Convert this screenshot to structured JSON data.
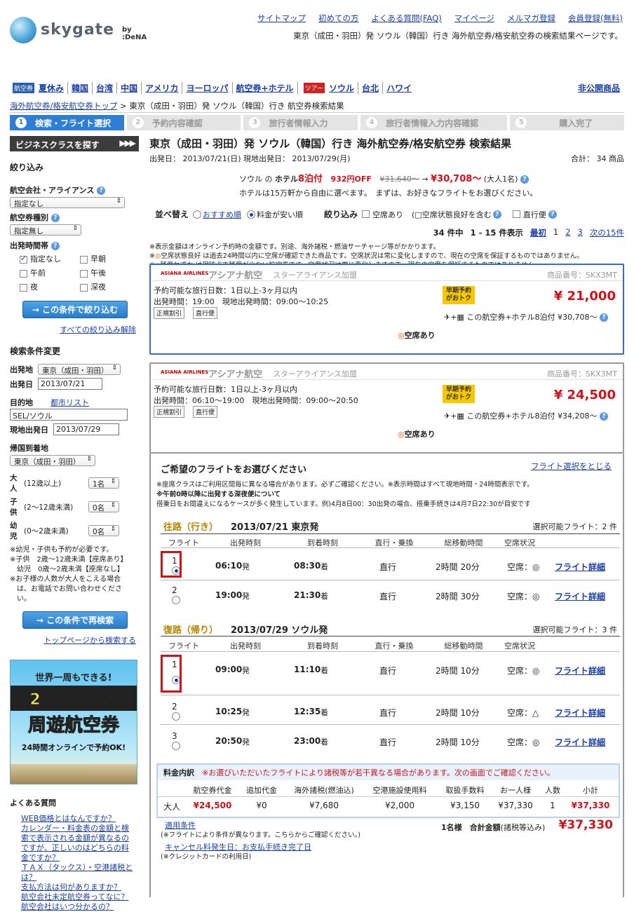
{
  "header": {
    "logo_text": "skygate",
    "logo_by": "by :DeNA",
    "links": [
      "サイトマップ",
      "初めての方",
      "よくある質問(FAQ)",
      "マイページ",
      "メルマガ登録",
      "会員登録(無料)"
    ],
    "caption": "東京（成田・羽田）発 ソウル（韓国）行き 海外航空券/格安航空券の検索結果ページです。"
  },
  "catnav": {
    "tag1": "航空券",
    "tag2": "ツアー",
    "items1": [
      "夏休み",
      "韓国",
      "台湾",
      "中国",
      "アメリカ",
      "ヨーロッパ",
      "航空券+ホテル"
    ],
    "items2": [
      "ソウル",
      "台北",
      "ハワイ"
    ],
    "hidden": "非公開商品"
  },
  "breadcrumb": {
    "home": "海外航空券/格安航空券トップ",
    "current": "> 東京（成田・羽田）発 ソウル（韓国）行き 航空券検索結果"
  },
  "steps": [
    {
      "n": "1",
      "label": "検索・フライト選択"
    },
    {
      "n": "2",
      "label": "予約内容確認"
    },
    {
      "n": "3",
      "label": "旅行者情報入力"
    },
    {
      "n": "4",
      "label": "旅行者情報入力内容確認"
    },
    {
      "n": "5",
      "label": "購入完了"
    }
  ],
  "sidebar": {
    "biz": "ビジネスクラスを探す",
    "filter_title": "絞り込み",
    "airline_label": "航空会社・アライアンス",
    "airline_val": "指定なし",
    "ticket_label": "航空券種別",
    "ticket_val": "指定無し",
    "time_label": "出発時間帯",
    "times": [
      "指定なし",
      "早朝",
      "午前",
      "午後",
      "夜",
      "深夜"
    ],
    "filter_btn": "この条件で絞り込む",
    "clear": "すべての絞り込み解除",
    "search_title": "検索条件変更",
    "dep_label": "出発地",
    "dep_val": "東京（成田・羽田）",
    "depdate_label": "出発日",
    "depdate_val": "2013/07/21",
    "dest_label": "目的地",
    "city_list": "都市リスト",
    "dest_val": "SEL/ソウル",
    "localdate_label": "現地出発日",
    "localdate_val": "2013/07/29",
    "ret_label": "帰国到着地",
    "ret_val": "東京（成田・羽田）",
    "adult_label": "大人",
    "adult_sub": "(12歳以上)",
    "adult_val": "1名",
    "child_label": "子供",
    "child_sub": "(2〜12歳未満)",
    "child_val": "0名",
    "infant_label": "幼児",
    "infant_sub": "(0〜2歳未満)",
    "infant_val": "0名",
    "notes": [
      "※幼児・子供も予約が必要です。",
      "※子供　2歳〜12歳未満【座席あり】",
      "　幼児　0歳〜2歳未満【座席なし】",
      "※お子様の人数が大人をこえる場合",
      "　は、お電話でお問い合わせくださ",
      "　い。"
    ],
    "research_btn": "この条件で再検索",
    "top_search": "トップページから検索する",
    "banner": {
      "l1": "世界一周もできる!",
      "l2": "2都市以上の",
      "l3": "周遊航空券",
      "l4": "24時間オンラインで予約OK!"
    },
    "faq_title": "よくある質問",
    "faq": [
      "WEB価格とはなんですか？",
      "カレンダー・料金表の金額と検索で表示される金額が異なるのですが、正しいのはどちらの料金ですか？",
      "ＴＡＸ（タックス）・空港諸税とは？",
      "支払方法は何がありますか？",
      "航空会社未定航空券ってなに？",
      "航空会社はいつ分かるの？"
    ]
  },
  "main": {
    "title": "東京（成田・羽田）発 ソウル（韓国）行き 海外航空券/格安航空券 検索結果",
    "dates": "出発日： 2013/07/21(日) 現地出発日： 2013/07/29(月)",
    "total": "合計： 34 商品",
    "promo": {
      "city": "ソウル の",
      "hotel": "ホテル",
      "nights": "8泊付",
      "off": "932円OFF",
      "old": "¥31,640〜",
      "arrow": "→",
      "new": "¥30,708〜",
      "who": "(大人1名)",
      "line2": "ホテルは15万軒から自由に選べます。　まずは、お好きなフライトをお選びください。"
    },
    "sort_label": "並べ替え",
    "sort_rec": "おすすめ順",
    "sort_cheap": "料金が安い順",
    "filter_label": "絞り込み",
    "f1": "空席あり",
    "f2": "(□空席状態良好を含む",
    "f3": "直行便",
    "paging": {
      "count": "34 件中",
      "range": "1 - 15 件表示",
      "first": "最初",
      "p1": "1",
      "p2": "2",
      "p3": "3",
      "next": "次の15件"
    },
    "notices": [
      "※表示金額はオンライン予約時の金額です。別途、海外諸税・燃油サーチャージ等がかかります。",
      "空席状態良好 は過去24時間以内に空席が確認できた商品です。空席状況は常に変化しますので、現在の空席を保証するものではありません。",
      "残席わずか は現時点で残席が少ない航空券です。空席状況は常に変化しますので、現在の空席を保証するものではありません。"
    ],
    "cards": [
      {
        "airline": "アシアナ航空",
        "alliance": "スターアライアンス加盟",
        "code": "商品番号：SKX3MT",
        "logo": "ASIANA AIRLINES",
        "l1": "予約可能な旅行日数：1日以上-3ヶ月以内",
        "l2": "出発時間：19:00　現地出発時間：09:00〜10:25",
        "badge": "早期予約がおトク",
        "price": "¥ 21,000",
        "b1": "正規割引",
        "b2": "直行便",
        "hotel": "この航空券+ホテル8泊付 ¥30,708〜",
        "seat": "空席あり"
      },
      {
        "airline": "アシアナ航空",
        "alliance": "スターアライアンス加盟",
        "code": "商品番号：SKX3MT",
        "logo": "ASIANA AIRLINES",
        "l1": "予約可能な旅行日数：1日以上-3ヶ月以内",
        "l2": "出発時間：06:10〜19:00　現地出発時間：09:00〜20:50",
        "badge": "早期予約がおトク",
        "price": "¥ 24,500",
        "b1": "正規割引",
        "b2": "直行便",
        "hotel": "この航空券+ホテル8泊付 ¥34,208〜",
        "seat": "空席あり"
      }
    ],
    "select": {
      "title": "ご希望のフライトをお選びください",
      "close": "フライト選択をとじる",
      "n1": "※座席クラスはご利用区間毎に異なる場合があります。必ずご確認ください。※表示時間はすべて現地時間・24時間表示です。",
      "n2": "※午前0時以降に出発する深夜便について",
      "n3": "搭乗日をお間違えになるケースが多く発生しています。例)4月8日00：30出発の場合、搭乗手続きは4月7日22:30が目安です",
      "out_label": "往路（行き）",
      "out_date": "2013/07/21 東京発",
      "out_count": "選択可能フライト：2 件",
      "in_label": "復路（帰り）",
      "in_date": "2013/07/29 ソウル発",
      "in_count": "選択可能フライト：3 件",
      "cols": [
        "フライト",
        "出発時刻",
        "到着時刻",
        "直行・乗換",
        "総移動時間",
        "空席状況"
      ],
      "out": [
        {
          "n": "1",
          "dep": "06:10",
          "arr": "08:30",
          "type": "直行",
          "dur": "2時間 20分",
          "seat": "空席：◎",
          "sel": true
        },
        {
          "n": "2",
          "dep": "19:00",
          "arr": "21:30",
          "type": "直行",
          "dur": "2時間 30分",
          "seat": "空席：◎",
          "sel": false
        }
      ],
      "in": [
        {
          "n": "1",
          "dep": "09:00",
          "arr": "11:10",
          "type": "直行",
          "dur": "2時間 10分",
          "seat": "空席：◎",
          "sel": true
        },
        {
          "n": "2",
          "dep": "10:25",
          "arr": "12:35",
          "type": "直行",
          "dur": "2時間 10分",
          "seat": "空席：△",
          "sel": false
        },
        {
          "n": "3",
          "dep": "20:50",
          "arr": "23:00",
          "type": "直行",
          "dur": "2時間 10分",
          "seat": "空席：◎",
          "sel": false
        }
      ],
      "dep_suffix": "発",
      "arr_suffix": "着",
      "detail": "フライト詳細"
    },
    "fare": {
      "title": "料金内訳",
      "warn": "※お選びいただいたフライトにより諸税等が若干異なる場合があります。次の画面でご確認ください。",
      "cols": [
        "航空券代金",
        "追加代金",
        "海外諸税(燃油込)",
        "空港施設使用料",
        "取扱手数料",
        "お一人様",
        "人数",
        "小計"
      ],
      "row_label": "大人",
      "row": [
        "¥24,500",
        "¥0",
        "¥7,680",
        "¥2,000",
        "¥3,150",
        "¥37,330",
        "1",
        "¥37,330"
      ],
      "terms": "適用条件",
      "terms_note": "(※フライトにより条件が異なります。こちらからご確認ください。)",
      "cancel": "キャンセル料発生日：お支払手続き完了日",
      "cancel_note": "(※クレジットカードの利用日)",
      "sum_label": "1名様　合計金額",
      "sum_sub": "(諸税等込み)",
      "sum": "¥37,330"
    }
  }
}
